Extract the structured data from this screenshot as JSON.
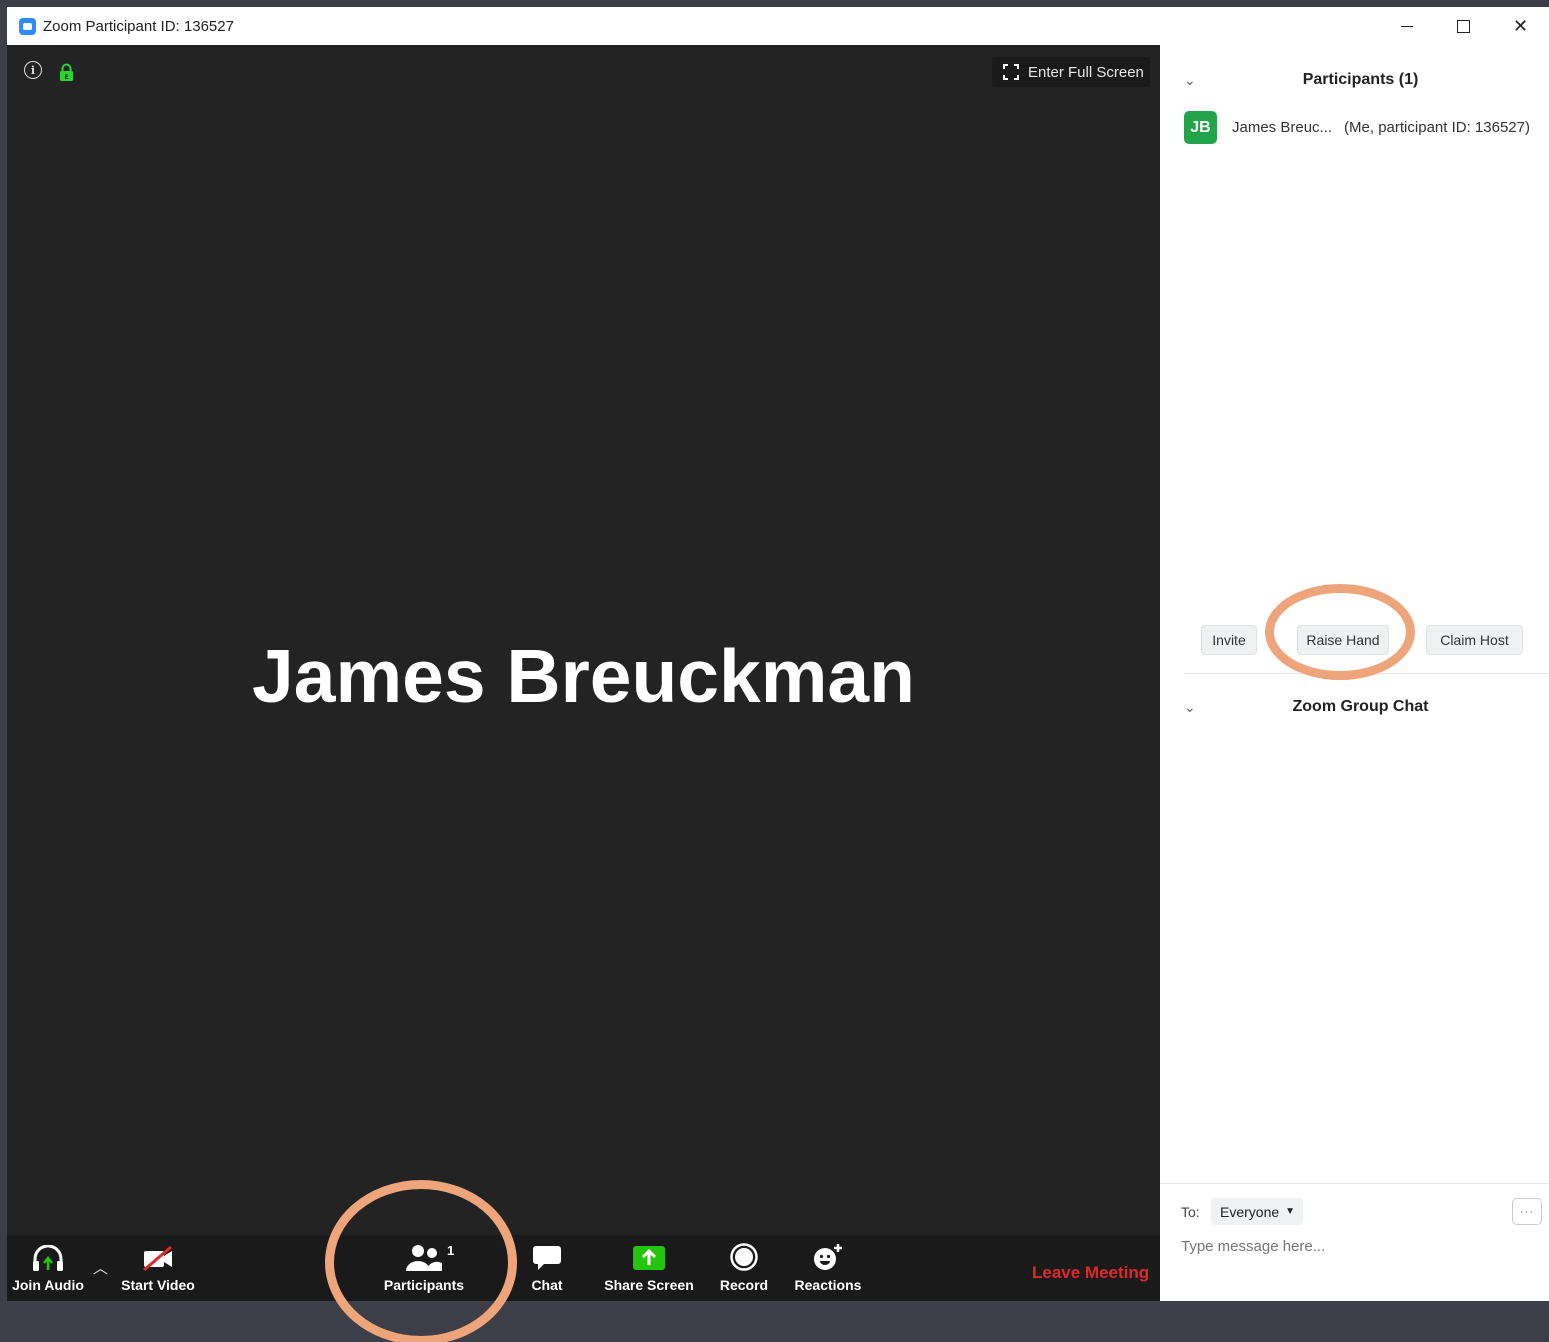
{
  "window": {
    "title": "Zoom Participant ID: 136527",
    "controls": {
      "minimize": "",
      "maximize": "",
      "close": "✕"
    }
  },
  "meeting": {
    "fullscreen_label": "Enter Full Screen",
    "speaker_name": "James Breuckman"
  },
  "toolbar": {
    "join_audio": "Join Audio",
    "start_video": "Start Video",
    "participants": "Participants",
    "participants_count": "1",
    "chat": "Chat",
    "share_screen": "Share Screen",
    "record": "Record",
    "reactions": "Reactions",
    "leave": "Leave Meeting"
  },
  "sidebar": {
    "participants_title": "Participants (1)",
    "participants": [
      {
        "initials": "JB",
        "name": "James Breuc...",
        "tag": "(Me, participant ID: 136527)"
      }
    ],
    "buttons": {
      "invite": "Invite",
      "raise_hand": "Raise Hand",
      "claim_host": "Claim Host"
    },
    "chat_title": "Zoom Group Chat",
    "to_label": "To:",
    "to_value": "Everyone",
    "more": "···",
    "message_placeholder": "Type message here..."
  },
  "colors": {
    "meeting_bg": "#232323",
    "toolbar_bg": "#1a1a1a",
    "leave_red": "#e02828",
    "share_green": "#25c40f",
    "avatar_green": "#23a44b",
    "annotation_ring": "#eea57c"
  }
}
